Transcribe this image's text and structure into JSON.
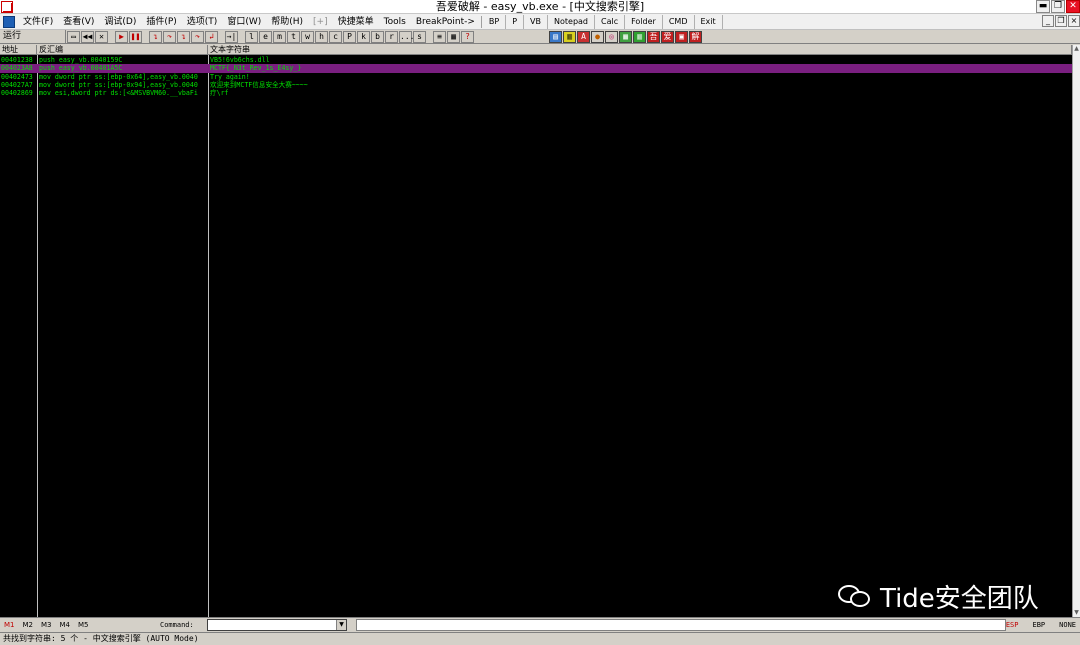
{
  "window": {
    "title": "吾爱破解 - easy_vb.exe - [中文搜索引擎]",
    "minimize": "▬",
    "restore": "❐",
    "close": "✕"
  },
  "menu": {
    "items": [
      "文件(F)",
      "查看(V)",
      "调试(D)",
      "插件(P)",
      "选项(T)",
      "窗口(W)",
      "帮助(H)"
    ],
    "disabled_item": "[+]",
    "extra_items": [
      "快捷菜单",
      "Tools",
      "BreakPoint->"
    ],
    "buttons": [
      "BP",
      "P",
      "VB",
      "Notepad",
      "Calc",
      "Folder",
      "CMD",
      "Exit"
    ],
    "mdi_minimize": "_",
    "mdi_restore": "❐",
    "mdi_close": "×"
  },
  "toolbar": {
    "status": "运行",
    "exec_buttons": [
      "▭",
      "◀◀",
      "✕",
      "▶",
      "❚❚",
      "↴",
      "↷",
      "↴",
      "↷",
      "↲",
      "→|"
    ],
    "letter_buttons": [
      "l",
      "e",
      "m",
      "t",
      "w",
      "h",
      "c",
      "P",
      "k",
      "b",
      "r",
      "...",
      "s"
    ],
    "tool_buttons": [
      "≡",
      "▦",
      "?"
    ],
    "plugin_buttons": [
      "▤",
      "▥",
      "A",
      "●",
      "◎",
      "▦",
      "▥",
      "吾",
      "爱",
      "▣",
      "解"
    ]
  },
  "columns": {
    "address": "地址",
    "disassembly": "反汇编",
    "text": "文本字符串"
  },
  "rows": [
    {
      "address": "00401238",
      "disasm": "push easy_vb.0040159C",
      "text": "VB5!6vb6chs.dll",
      "selected": false
    },
    {
      "address": "004023A8",
      "disasm": "push easy_vb.00401A5C",
      "text": "MCTF{_N3t_Rev_1s_E4sy_}",
      "selected": true
    },
    {
      "address": "00402473",
      "disasm": "mov dword ptr ss:[ebp-0x64],easy_vb.0040",
      "text": "Try again!",
      "selected": false
    },
    {
      "address": "004027A7",
      "disasm": "mov dword ptr ss:[ebp-0x94],easy_vb.0040",
      "text": "欢迎来到MCTF信息安全大赛~~~~",
      "selected": false
    },
    {
      "address": "00402869",
      "disasm": "mov esi,dword ptr ds:[<&MSVBVM60.__vbaFi",
      "text": "疗\\rf",
      "selected": false
    }
  ],
  "watermark": {
    "text": "Tide安全团队"
  },
  "command_bar": {
    "tabs": [
      "M1",
      "M2",
      "M3",
      "M4",
      "M5"
    ],
    "label": "Command:",
    "dropdown_glyph": "▼",
    "registers": [
      "ESP",
      "EBP",
      "NONE"
    ]
  },
  "status_bar": {
    "text": "共找到字符串: 5 个  -  中文搜索引擎 (AUTO Mode)"
  },
  "colors": {
    "text_green": "#00e000",
    "selection": "#7a1f80",
    "background": "#000000"
  }
}
